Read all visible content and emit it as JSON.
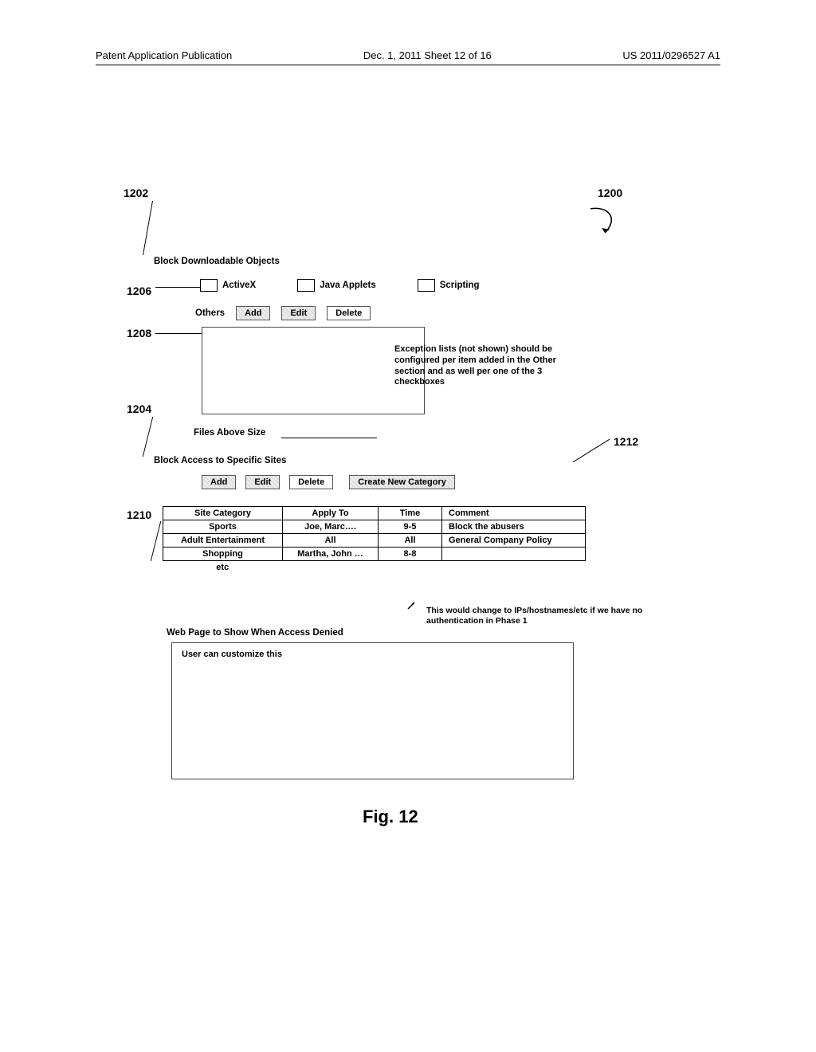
{
  "header": {
    "left": "Patent Application Publication",
    "center": "Dec. 1, 2011  Sheet 12 of 16",
    "right": "US 2011/0296527 A1"
  },
  "refs": {
    "r1200": "1200",
    "r1202": "1202",
    "r1204": "1204",
    "r1206": "1206",
    "r1208": "1208",
    "r1210": "1210",
    "r1212": "1212"
  },
  "sec1202": {
    "title": "Block Downloadable Objects",
    "cb1": "ActiveX",
    "cb2": "Java Applets",
    "cb3": "Scripting",
    "others": "Others",
    "btn_add": "Add",
    "btn_edit": "Edit",
    "btn_delete": "Delete",
    "exc_note": "Exception lists (not shown) should be configured per item added in the Other section and as well per one of the 3 checkboxes"
  },
  "files": {
    "label": "Files Above Size"
  },
  "sec1204": {
    "title": "Block Access to Specific Sites",
    "btn_add": "Add",
    "btn_edit": "Edit",
    "btn_delete": "Delete",
    "btn_create": "Create New Category"
  },
  "table": {
    "h1": "Site Category",
    "h2": "Apply To",
    "h3": "Time",
    "h4": "Comment",
    "rows": [
      {
        "c1": "Sports",
        "c2": "Joe, Marc….",
        "c3": "9-5",
        "c4": "Block the abusers"
      },
      {
        "c1": "Adult Entertainment",
        "c2": "All",
        "c3": "All",
        "c4": "General Company Policy"
      },
      {
        "c1": "Shopping",
        "c2": "Martha, John …",
        "c3": "8-8",
        "c4": ""
      }
    ],
    "etc": "etc"
  },
  "table_note": "This would change to IPs/hostnames/etc if we have no authentication in Phase 1",
  "denied": {
    "label": "Web Page to Show When Access Denied",
    "placeholder": "User can customize this"
  },
  "figure_label": "Fig. 12"
}
